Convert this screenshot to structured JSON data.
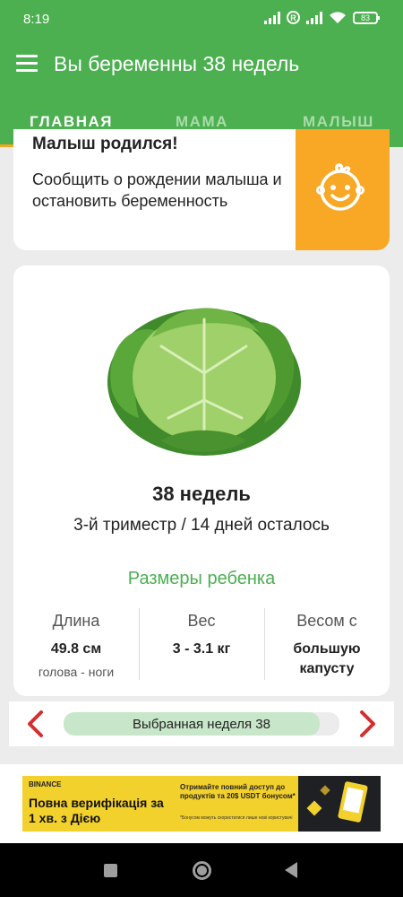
{
  "status_bar": {
    "time": "8:19",
    "battery": "83"
  },
  "app_bar": {
    "title": "Вы беременны 38 недель"
  },
  "tabs": [
    {
      "label": "ГЛАВНАЯ",
      "active": true
    },
    {
      "label": "МАМА",
      "active": false
    },
    {
      "label": "МАЛЫШ",
      "active": false
    }
  ],
  "baby_born_card": {
    "title": "Малыш родился!",
    "text": "Сообщить о рождении малыша и остановить беременность",
    "icon": "baby-face-icon"
  },
  "week_card": {
    "image": "cabbage",
    "weeks": "38 недель",
    "trimester": "3-й триместр / 14 дней осталось",
    "sizes_title": "Размеры ребенка",
    "stats": [
      {
        "label": "Длина",
        "value": "49.8 см",
        "sub": "голова - ноги"
      },
      {
        "label": "Вес",
        "value": "3 - 3.1 кг",
        "sub": ""
      },
      {
        "label": "Весом с",
        "value": "большую капусту",
        "sub": ""
      }
    ]
  },
  "week_selector": {
    "label": "Выбранная неделя 38",
    "progress": 0.93
  },
  "ad": {
    "brand": "BINANCE",
    "headline": "Повна верифікація за 1 хв. з Дією",
    "text": "Отримайте повний доступ до продуктів та 20$ USDT бонусом*",
    "fine_print": "*Бонусом можуть скористатися лише нові користувачі"
  },
  "colors": {
    "primary": "#4caf50",
    "accent": "#f9a825"
  }
}
